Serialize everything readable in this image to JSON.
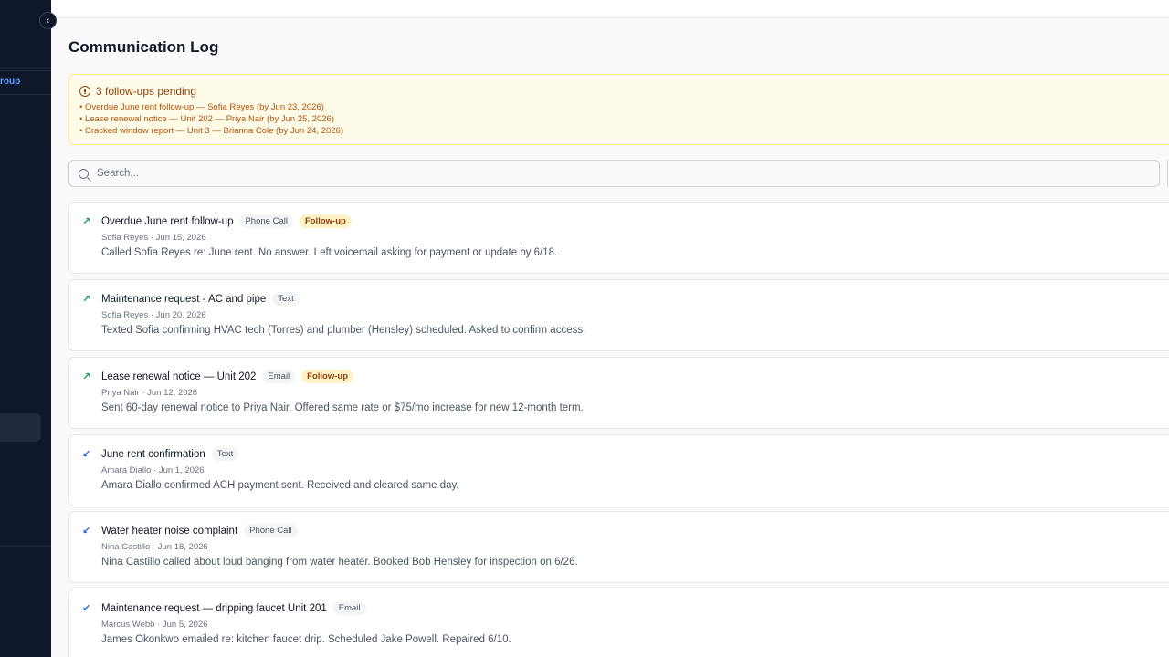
{
  "sidebar": {
    "group_link": "roup",
    "collapse_icon": "chevron-left-icon",
    "collapse_glyph": "‹"
  },
  "page": {
    "title": "Communication Log"
  },
  "alert": {
    "icon": "alert-circle-icon",
    "title": "3 follow-ups pending",
    "items": [
      "Overdue June rent follow-up — Sofia Reyes (by Jun 23, 2026)",
      "Lease renewal notice — Unit 202 — Priya Nair (by Jun 25, 2026)",
      "Cracked window report — Unit 3 — Brianna Cole (by Jun 24, 2026)"
    ]
  },
  "search": {
    "placeholder": "Search...",
    "value": ""
  },
  "colors": {
    "sidebar_bg": "#0f172a",
    "accent": "#60a5fa",
    "outgoing": "#16a34a",
    "incoming": "#2563eb",
    "followup_bg": "#fef3c7"
  },
  "log": [
    {
      "direction": "outgoing",
      "icon": "arrow-up-right-icon",
      "glyph": "↗",
      "title": "Overdue June rent follow-up",
      "type": "Phone Call",
      "follow_up": "Follow-up",
      "meta": "Sofia Reyes · Jun 15, 2026",
      "body": "Called Sofia Reyes re: June rent. No answer. Left voicemail asking for payment or update by 6/18."
    },
    {
      "direction": "outgoing",
      "icon": "arrow-up-right-icon",
      "glyph": "↗",
      "title": "Maintenance request - AC and pipe",
      "type": "Text",
      "follow_up": null,
      "meta": "Sofia Reyes · Jun 20, 2026",
      "body": "Texted Sofia confirming HVAC tech (Torres) and plumber (Hensley) scheduled. Asked to confirm access."
    },
    {
      "direction": "outgoing",
      "icon": "arrow-up-right-icon",
      "glyph": "↗",
      "title": "Lease renewal notice — Unit 202",
      "type": "Email",
      "follow_up": "Follow-up",
      "meta": "Priya Nair · Jun 12, 2026",
      "body": "Sent 60-day renewal notice to Priya Nair. Offered same rate or $75/mo increase for new 12-month term."
    },
    {
      "direction": "incoming",
      "icon": "arrow-down-left-icon",
      "glyph": "↙",
      "title": "June rent confirmation",
      "type": "Text",
      "follow_up": null,
      "meta": "Amara Diallo · Jun 1, 2026",
      "body": "Amara Diallo confirmed ACH payment sent. Received and cleared same day."
    },
    {
      "direction": "incoming",
      "icon": "arrow-down-left-icon",
      "glyph": "↙",
      "title": "Water heater noise complaint",
      "type": "Phone Call",
      "follow_up": null,
      "meta": "Nina Castillo · Jun 18, 2026",
      "body": "Nina Castillo called about loud banging from water heater. Booked Bob Hensley for inspection on 6/26."
    },
    {
      "direction": "incoming",
      "icon": "arrow-down-left-icon",
      "glyph": "↙",
      "title": "Maintenance request — dripping faucet Unit 201",
      "type": "Email",
      "follow_up": null,
      "meta": "Marcus Webb · Jun 5, 2026",
      "body": "James Okonkwo emailed re: kitchen faucet drip. Scheduled Jake Powell. Repaired 6/10."
    }
  ]
}
